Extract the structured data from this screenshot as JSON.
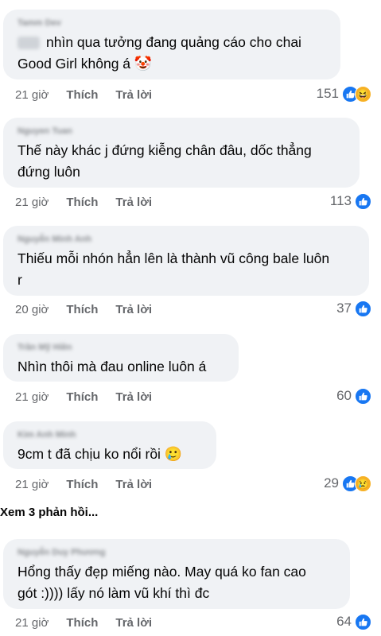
{
  "comments": [
    {
      "author": "Tamm Dev",
      "text_line1": "nhìn qua tưởng đang quảng cáo cho chai",
      "text_line2": "Good Girl không á",
      "text_emoji": "🤡",
      "time": "21 giờ",
      "like_label": "Thích",
      "reply_label": "Trả lời",
      "reaction_count": "151",
      "reactions": [
        "like",
        "haha"
      ],
      "reaction_emoji": "😆"
    },
    {
      "author": "Nguyen Tuan",
      "text_line1": "Thế này khác j đứng kiễng chân đâu, dốc thẳng",
      "text_line2": "đứng luôn",
      "time": "21 giờ",
      "like_label": "Thích",
      "reply_label": "Trả lời",
      "reaction_count": "113",
      "reactions": [
        "like"
      ]
    },
    {
      "author": "Nguyễn Minh Anh",
      "text_line1": "Thiếu mỗi nhón hẳn lên là thành vũ công bale luôn",
      "text_line2": "r",
      "time": "20 giờ",
      "like_label": "Thích",
      "reply_label": "Trả lời",
      "reaction_count": "37",
      "reactions": [
        "like"
      ]
    },
    {
      "author": "Trần Mỹ Hiền",
      "text_line1": "Nhìn thôi mà đau online luôn á",
      "time": "21 giờ",
      "like_label": "Thích",
      "reply_label": "Trả lời",
      "reaction_count": "60",
      "reactions": [
        "like"
      ]
    },
    {
      "author": "Kim Anh Minh",
      "text_line1": "9cm t đã chịu ko nổi rồi",
      "text_emoji": "🥲",
      "time": "21 giờ",
      "like_label": "Thích",
      "reply_label": "Trả lời",
      "reaction_count": "29",
      "reactions": [
        "like",
        "sad"
      ],
      "reaction_emoji": "😢"
    },
    {
      "author": "Nguyễn Duy Phương",
      "text_line1": "Hổng thấy đẹp miếng nào. May quá ko fan cao",
      "text_line2": "gót :)))) lấy nó làm vũ khí thì đc",
      "time": "21 giờ",
      "like_label": "Thích",
      "reply_label": "Trả lời",
      "reaction_count": "64",
      "reactions": [
        "like"
      ]
    }
  ],
  "more_replies_label": "Xem 3 phản hồi...",
  "colors": {
    "bubble": "#f0f2f5",
    "like_blue": "#1877f2",
    "meta_gray": "#65676b"
  }
}
